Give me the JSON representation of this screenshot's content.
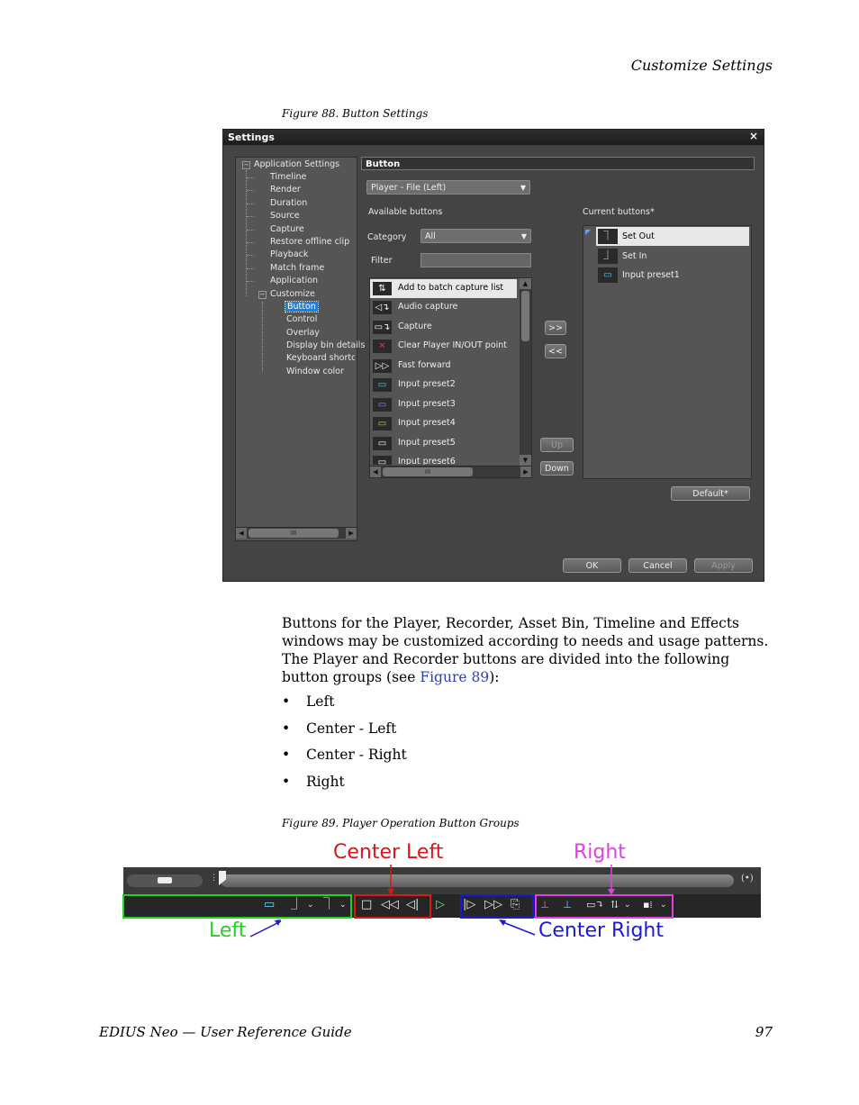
{
  "header": {
    "section": "Customize Settings"
  },
  "figure88": {
    "caption": "Figure 88.  Button Settings"
  },
  "dialog": {
    "title": "Settings",
    "close": "×",
    "tree": [
      {
        "label": "Application Settings",
        "expander": "−"
      },
      {
        "label": "Timeline"
      },
      {
        "label": "Render"
      },
      {
        "label": "Duration"
      },
      {
        "label": "Source"
      },
      {
        "label": "Capture"
      },
      {
        "label": "Restore offline clip"
      },
      {
        "label": "Playback"
      },
      {
        "label": "Match frame"
      },
      {
        "label": "Application"
      },
      {
        "label": "Customize",
        "expander": "−"
      },
      {
        "label": "Button"
      },
      {
        "label": "Control"
      },
      {
        "label": "Overlay"
      },
      {
        "label": "Display bin details"
      },
      {
        "label": "Keyboard shortcut"
      },
      {
        "label": "Window color"
      }
    ],
    "tree_scroll": "III",
    "section_title": "Button",
    "target_combo": "Player - File (Left)",
    "available_label": "Available buttons",
    "current_label": "Current buttons*",
    "category_label": "Category",
    "category_value": "All",
    "filter_label": "Filter",
    "filter_value": "",
    "available": [
      {
        "icon": "⇅",
        "label": "Add to batch capture list"
      },
      {
        "icon": "◁↴",
        "label": "Audio capture"
      },
      {
        "icon": "▭↴",
        "label": "Capture"
      },
      {
        "icon": "✕",
        "label": "Clear Player IN/OUT point"
      },
      {
        "icon": "▷▷",
        "label": "Fast forward"
      },
      {
        "icon": "▭",
        "label": "Input preset2"
      },
      {
        "icon": "▭",
        "label": "Input preset3"
      },
      {
        "icon": "▭",
        "label": "Input preset4"
      },
      {
        "icon": "▭",
        "label": "Input preset5"
      },
      {
        "icon": "▭",
        "label": "Input preset6"
      }
    ],
    "avail_scroll": "III",
    "current": [
      {
        "icon": "⏋",
        "label": "Set Out"
      },
      {
        "icon": "⏌",
        "label": "Set In"
      },
      {
        "icon": "▭",
        "label": "Input preset1"
      }
    ],
    "add_btn": ">>",
    "remove_btn": "<<",
    "up_btn": "Up",
    "down_btn": "Down",
    "default_btn": "Default*",
    "ok_btn": "OK",
    "cancel_btn": "Cancel",
    "apply_btn": "Apply"
  },
  "body": {
    "para_prefix": "Buttons for the Player, Recorder, Asset Bin, Timeline and Effects windows may be customized according to needs and usage patterns. The Player and Recorder buttons are divided into the following button groups (see ",
    "para_link": "Figure 89",
    "para_suffix": "):",
    "bullets": [
      "Left",
      "Center - Left",
      "Center - Right",
      "Right"
    ]
  },
  "figure89": {
    "caption": "Figure 89.  Player Operation Button Groups",
    "annotations": {
      "left": "Left",
      "center_left": "Center Left",
      "center_right": "Center Right",
      "right": "Right"
    },
    "colors": {
      "left": "#1fd21f",
      "center_left": "#e01515",
      "center_right": "#1a1ad8",
      "right": "#e040e0"
    }
  },
  "footer": {
    "title": "EDIUS Neo  —  User Reference Guide",
    "page": "97"
  }
}
